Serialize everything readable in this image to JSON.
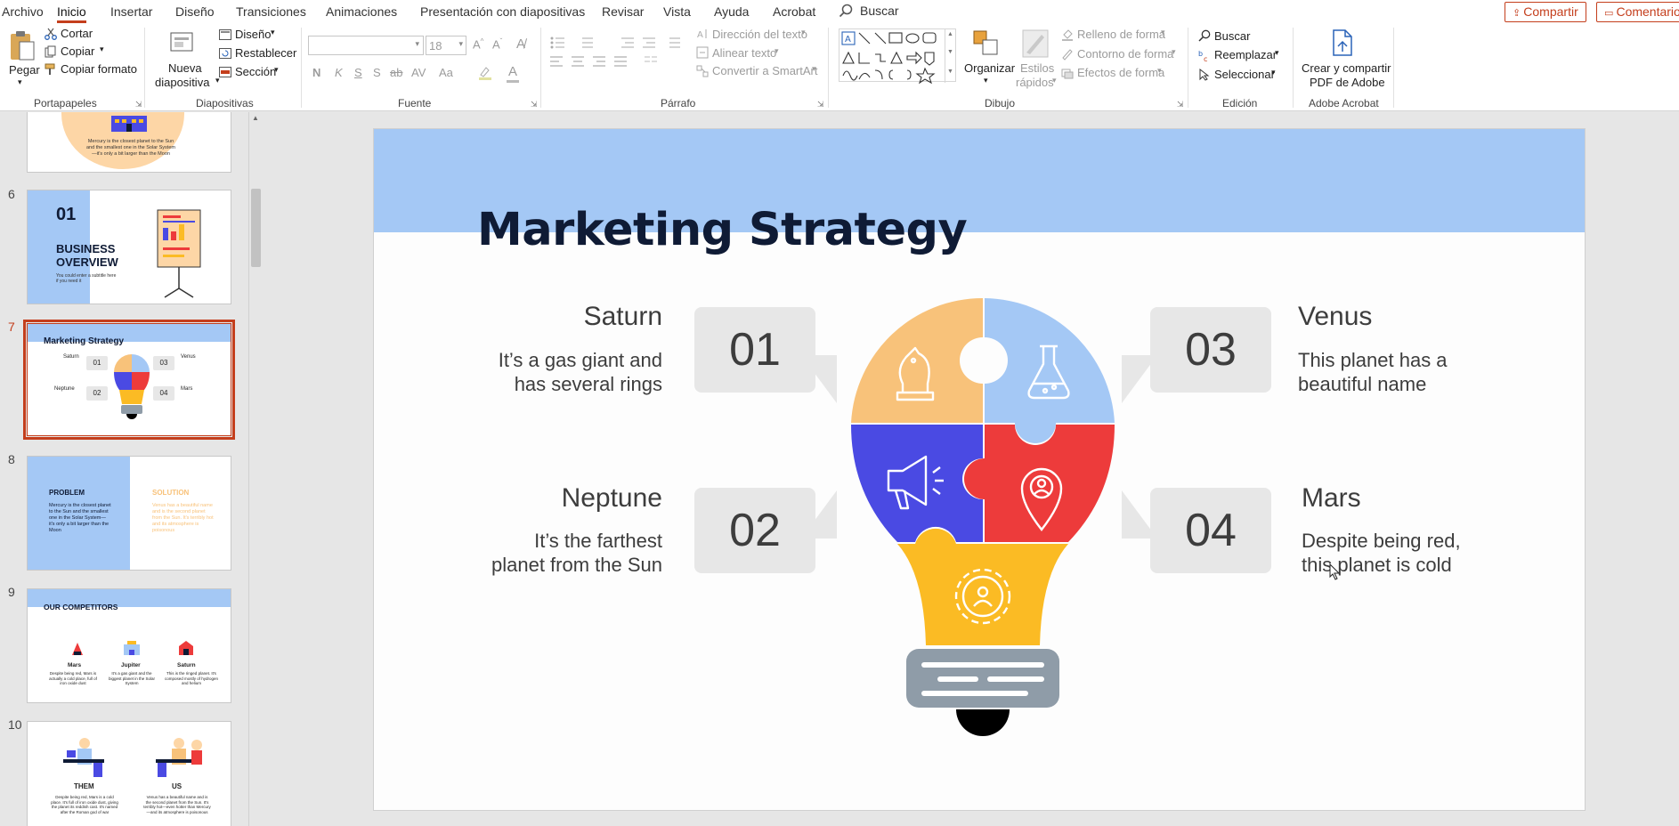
{
  "menu": {
    "tabs": [
      "Archivo",
      "Inicio",
      "Insertar",
      "Diseño",
      "Transiciones",
      "Animaciones",
      "Presentación con diapositivas",
      "Revisar",
      "Vista",
      "Ayuda",
      "Acrobat"
    ],
    "active_tab": "Inicio",
    "search_label": "Buscar",
    "share_label": "Compartir",
    "comments_label": "Comentarios"
  },
  "ribbon": {
    "clipboard": {
      "paste": "Pegar",
      "cut": "Cortar",
      "copy": "Copiar",
      "format_painter": "Copiar formato",
      "label": "Portapapeles"
    },
    "slides": {
      "new_slide_line1": "Nueva",
      "new_slide_line2": "diapositiva",
      "layout": "Diseño",
      "reset": "Restablecer",
      "section": "Sección",
      "label": "Diapositivas"
    },
    "font": {
      "font_name": "",
      "font_size": "18",
      "label": "Fuente",
      "buttons": [
        "N",
        "K",
        "S",
        "S",
        "ab",
        "AV",
        "Aa"
      ]
    },
    "paragraph": {
      "text_direction": "Dirección del texto",
      "align_text": "Alinear texto",
      "convert_smartart": "Convertir a SmartArt",
      "label": "Párrafo"
    },
    "drawing": {
      "arrange": "Organizar",
      "quick_styles_line1": "Estilos",
      "quick_styles_line2": "rápidos",
      "shape_fill": "Relleno de forma",
      "shape_outline": "Contorno de forma",
      "shape_effects": "Efectos de forma",
      "label": "Dibujo"
    },
    "editing": {
      "find": "Buscar",
      "replace": "Reemplazar",
      "select": "Seleccionar",
      "label": "Edición"
    },
    "acrobat": {
      "create_line1": "Crear y compartir",
      "create_line2": "PDF de Adobe",
      "label": "Adobe Acrobat"
    }
  },
  "thumbnails": {
    "numbers": [
      "6",
      "7",
      "8",
      "9",
      "10"
    ],
    "slide5_text": "Mercury is the closest planet to the Sun and the smallest one in the Solar System—it's only a bit larger than the Moon",
    "slide6": {
      "number": "01",
      "title_line1": "BUSINESS",
      "title_line2": "OVERVIEW",
      "subtitle": "You could enter a subtitle here if you need it"
    },
    "slide7": {
      "title": "Marketing Strategy"
    },
    "slide8": {
      "problem_title": "PROBLEM",
      "problem_text": "Mercury is the closest planet to the Sun and the smallest one in the Solar System—it's only a bit larger than the Moon",
      "solution_title": "SOLUTION",
      "solution_text": "Venus has a beautiful name and is the second planet from the Sun. It's terribly hot and its atmosphere is poisonous"
    },
    "slide9": {
      "title": "OUR COMPETITORS",
      "names": [
        "Mars",
        "Jupiter",
        "Saturn"
      ],
      "texts": [
        "Despite being red, Mars is actually a cold place, full of iron oxide dust",
        "It's a gas giant and the biggest planet in the Solar System",
        "This is the ringed planet. It's composed mostly of hydrogen and helium"
      ]
    },
    "slide10": {
      "left_title": "THEM",
      "right_title": "US",
      "left_text": "Despite being red, Mars is a cold place. It's full of iron oxide dust, giving the planet its reddish cast. It's named after the Roman god of war",
      "right_text": "Venus has a beautiful name and is the second planet from the Sun. It's terribly hot—even hotter than Mercury—and its atmosphere is poisonous"
    }
  },
  "slide": {
    "title": "Marketing Strategy",
    "items": [
      {
        "number": "01",
        "name": "Saturn",
        "desc_line1": "It’s a gas giant and",
        "desc_line2": "has several rings"
      },
      {
        "number": "02",
        "name": "Neptune",
        "desc_line1": "It’s the farthest",
        "desc_line2": "planet from the Sun"
      },
      {
        "number": "03",
        "name": "Venus",
        "desc_line1": "This planet has a",
        "desc_line2": "beautiful name"
      },
      {
        "number": "04",
        "name": "Mars",
        "desc_line1": "Despite being red,",
        "desc_line2": "this planet is cold"
      }
    ],
    "colors": {
      "banner": "#a4c8f5",
      "orange": "#f8c27a",
      "blue_light": "#a4c8f5",
      "blue": "#4a4ae3",
      "red": "#ed3b3b",
      "yellow": "#fbbb24",
      "grey": "#8f9ca8",
      "title": "#0f1b35"
    }
  },
  "icons": {
    "chess": "chess-knight-icon",
    "flask": "flask-icon",
    "megaphone": "megaphone-icon",
    "location": "location-user-icon",
    "gear": "gear-user-icon"
  }
}
